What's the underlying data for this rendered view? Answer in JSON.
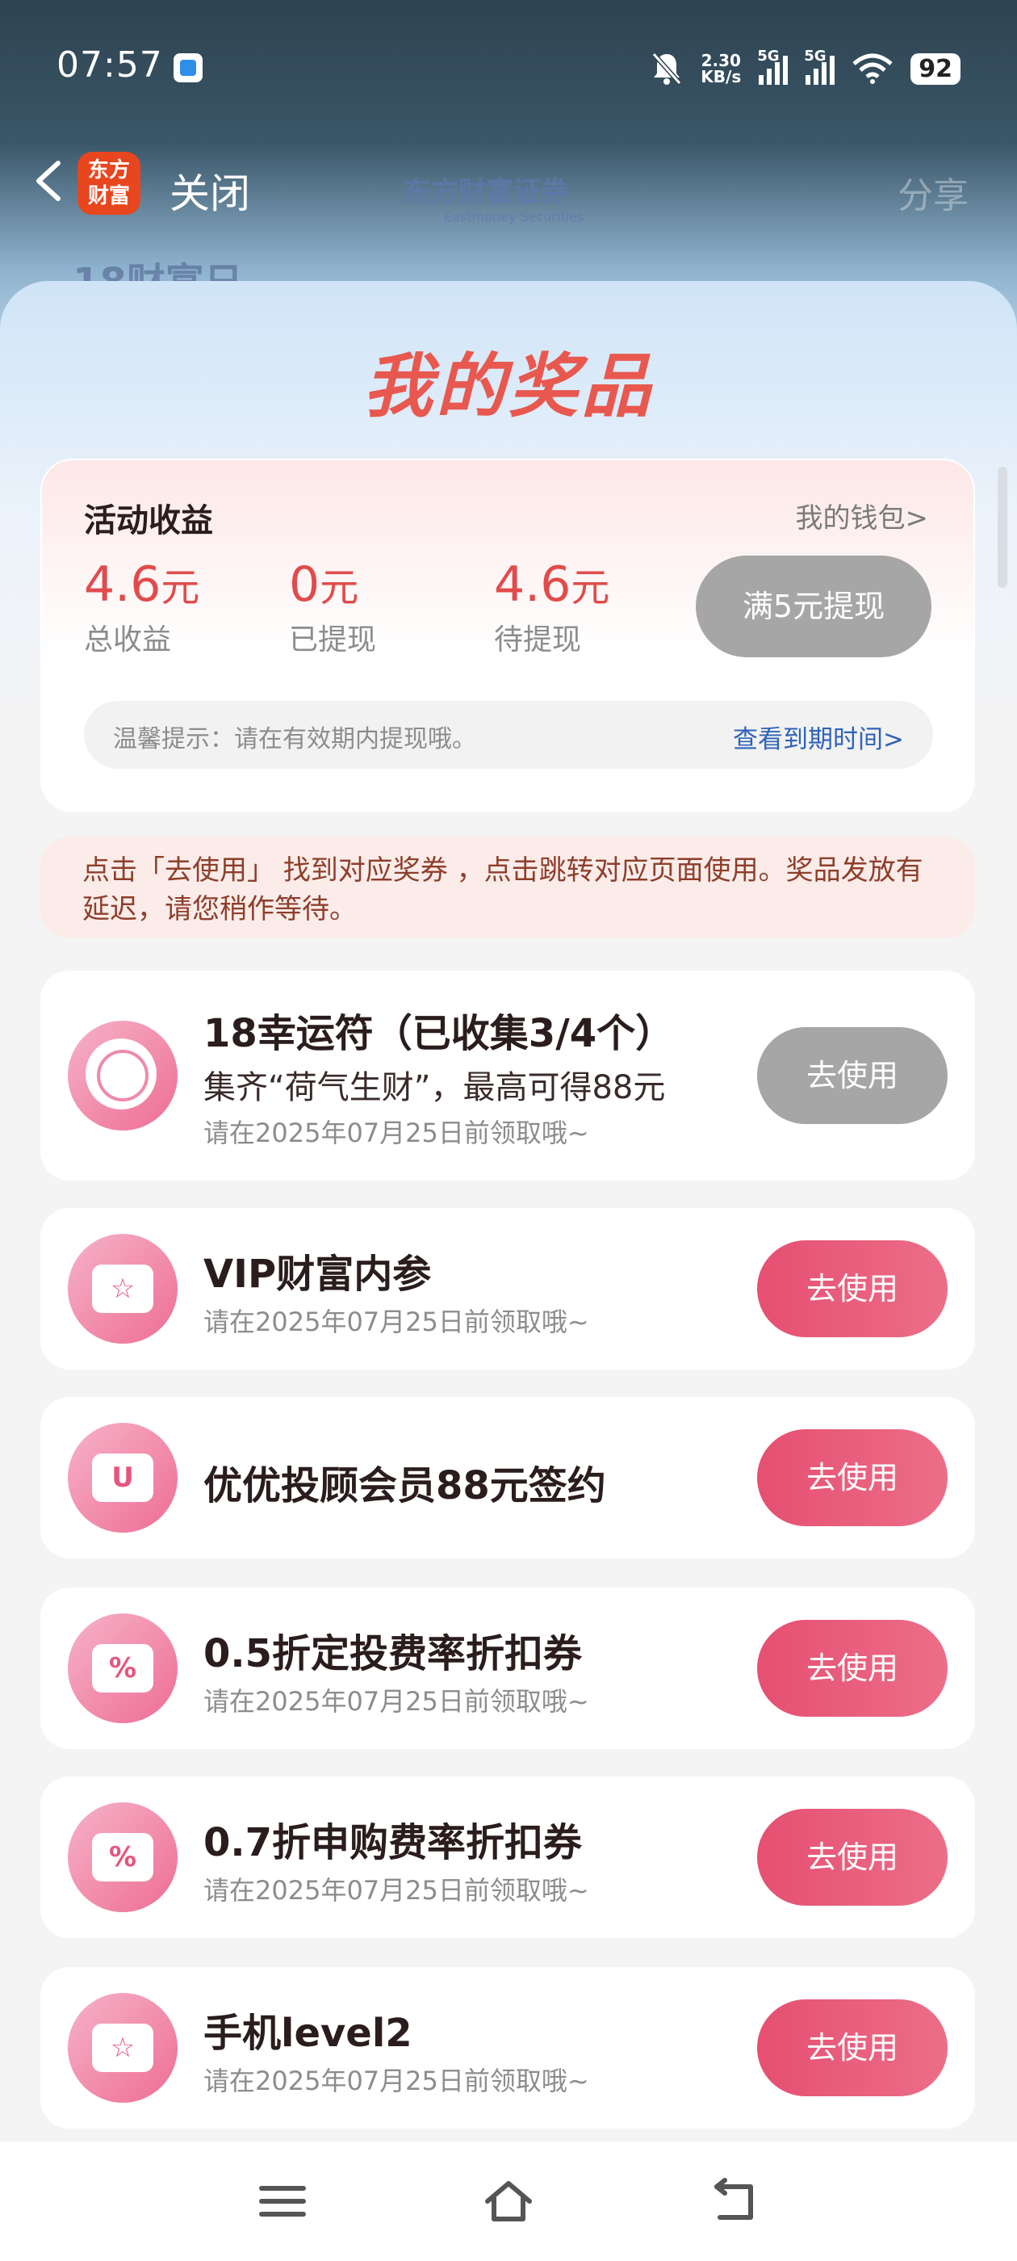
{
  "status_bar": {
    "time": "07:57",
    "net_speed": "2.30",
    "net_unit": "KB/s",
    "sim1": "5G",
    "sim2": "5G",
    "battery": "92",
    "icons": [
      "gallery-app-icon",
      "mute-icon",
      "signal-icon",
      "signal-icon",
      "wifi-icon",
      "battery-icon"
    ]
  },
  "header": {
    "brand_line1": "东方",
    "brand_line2": "财富",
    "close_label": "关闭",
    "securities_logo": "东方财富证券",
    "securities_logo_en": "Eastmoney Securities",
    "share_label": "分享",
    "underlay_text": "18财富日"
  },
  "sheet": {
    "title": "我的奖品",
    "earnings": {
      "title": "活动收益",
      "wallet_link": "我的钱包>",
      "stats": [
        {
          "value": "4.6",
          "unit": "元",
          "label": "总收益"
        },
        {
          "value": "0",
          "unit": "元",
          "label": "已提现"
        },
        {
          "value": "4.6",
          "unit": "元",
          "label": "待提现"
        }
      ],
      "withdraw_button": "满5元提现",
      "tip_text": "温馨提示：请在有效期内提现哦。",
      "tip_link": "查看到期时间>"
    },
    "notice": "点击「去使用」 找到对应奖券 ，点击跳转对应页面使用。奖品发放有延迟，请您稍作等待。",
    "prizes": [
      {
        "title": "18幸运符（已收集3/4个）",
        "subtitle": "集齐“荷气生财”，最高可得88元",
        "date": "请在2025年07月25日前领取哦~",
        "button": "去使用",
        "icon": "eastmoney-badge-icon",
        "enabled": false
      },
      {
        "title": "VIP财富内参",
        "date": "请在2025年07月25日前领取哦~",
        "button": "去使用",
        "icon": "star-ticket-icon",
        "enabled": true
      },
      {
        "title": "优优投顾会员88元签约",
        "button": "去使用",
        "icon": "u-ticket-icon",
        "enabled": true
      },
      {
        "title": "0.5折定投费率折扣券",
        "date": "请在2025年07月25日前领取哦~",
        "button": "去使用",
        "icon": "percent-ticket-icon",
        "enabled": true
      },
      {
        "title": "0.7折申购费率折扣券",
        "date": "请在2025年07月25日前领取哦~",
        "button": "去使用",
        "icon": "percent-ticket-icon",
        "enabled": true
      },
      {
        "title": "手机level2",
        "date": "请在2025年07月25日前领取哦~",
        "button": "去使用",
        "icon": "star-ticket-icon",
        "enabled": true
      }
    ],
    "icon_glyphs": {
      "percent": "%",
      "u": "U",
      "star": "☆"
    }
  },
  "nav_bar": {
    "icons": [
      "menu-icon",
      "home-icon",
      "back-icon"
    ]
  },
  "colors": {
    "accent": "#e64f72",
    "value_red": "#e14b4b",
    "disabled_gray": "#a6a6a6",
    "link_blue": "#2f63b8"
  }
}
